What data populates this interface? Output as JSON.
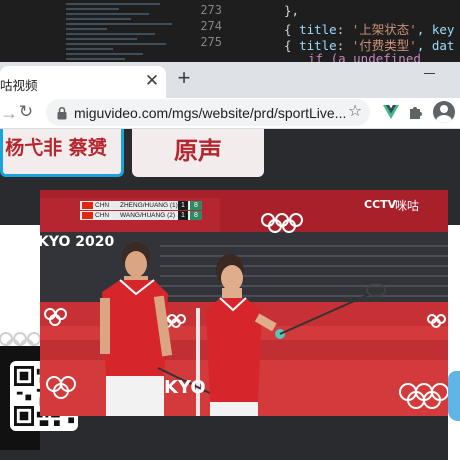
{
  "editor": {
    "line_numbers": [
      "273",
      "274",
      "275"
    ],
    "lines": [
      {
        "text": "},"
      },
      {
        "prefix": "{ ",
        "key": "title",
        "colon": ": ",
        "value": "'上架状态'",
        "rest": ", key"
      },
      {
        "prefix": "{ ",
        "key": "title",
        "colon": ": ",
        "value": "'付费类型'",
        "rest": ", dat"
      },
      {
        "text": "if (a      undefined"
      }
    ]
  },
  "browser": {
    "tab_title": "咕视频",
    "url_host": "miguvideo.com",
    "url_path": "/mgs/website/prd/sportLive...",
    "icons": [
      "close-icon",
      "plus-icon",
      "forward-icon",
      "reload-icon",
      "lock-icon",
      "star-icon",
      "vue-devtools-icon",
      "puzzle-icon",
      "profile-icon",
      "minimize-icon"
    ]
  },
  "page": {
    "commentator_left": "杨弋非 蔡赟",
    "commentator_right": "原声",
    "colors": {
      "accent_blue": "#1aa3dc",
      "commentator_red": "#b3262e",
      "olympic_red": "#d63636"
    }
  },
  "video": {
    "scoreboard": [
      {
        "country": "CHN",
        "team": "ZHENG/HUANG (1)",
        "sets": "1",
        "points": "8"
      },
      {
        "country": "CHN",
        "team": "WANG/HUANG (2)",
        "sets": "1",
        "points": "8"
      }
    ],
    "broadcaster": "CCTV",
    "stream_brand": "咪咕",
    "signage_left": "KYO 2020",
    "signage_right": "KYO"
  }
}
